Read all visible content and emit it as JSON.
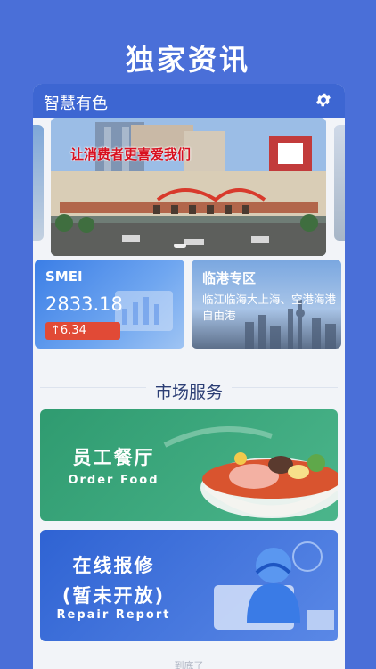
{
  "hero": {
    "title": "独家资讯"
  },
  "header": {
    "app_name": "智慧有色",
    "settings_icon": "gear-icon"
  },
  "banner": {
    "slogan": "让消费者更喜爱我们"
  },
  "cards": {
    "smei": {
      "title": "SMEI",
      "value": "2833.18",
      "change": "6.34",
      "change_color": "#e14a36"
    },
    "lingang": {
      "title": "临港专区",
      "description": "临江临海大上海、空港海港自由港"
    }
  },
  "section": {
    "title": "市场服务"
  },
  "services": {
    "food": {
      "title": "员工餐厅",
      "subtitle": "Order Food"
    },
    "repair": {
      "title": "在线报修",
      "title2": "(暂未开放)",
      "subtitle": "Repair Report"
    }
  },
  "footer": {
    "text": "到底了"
  }
}
